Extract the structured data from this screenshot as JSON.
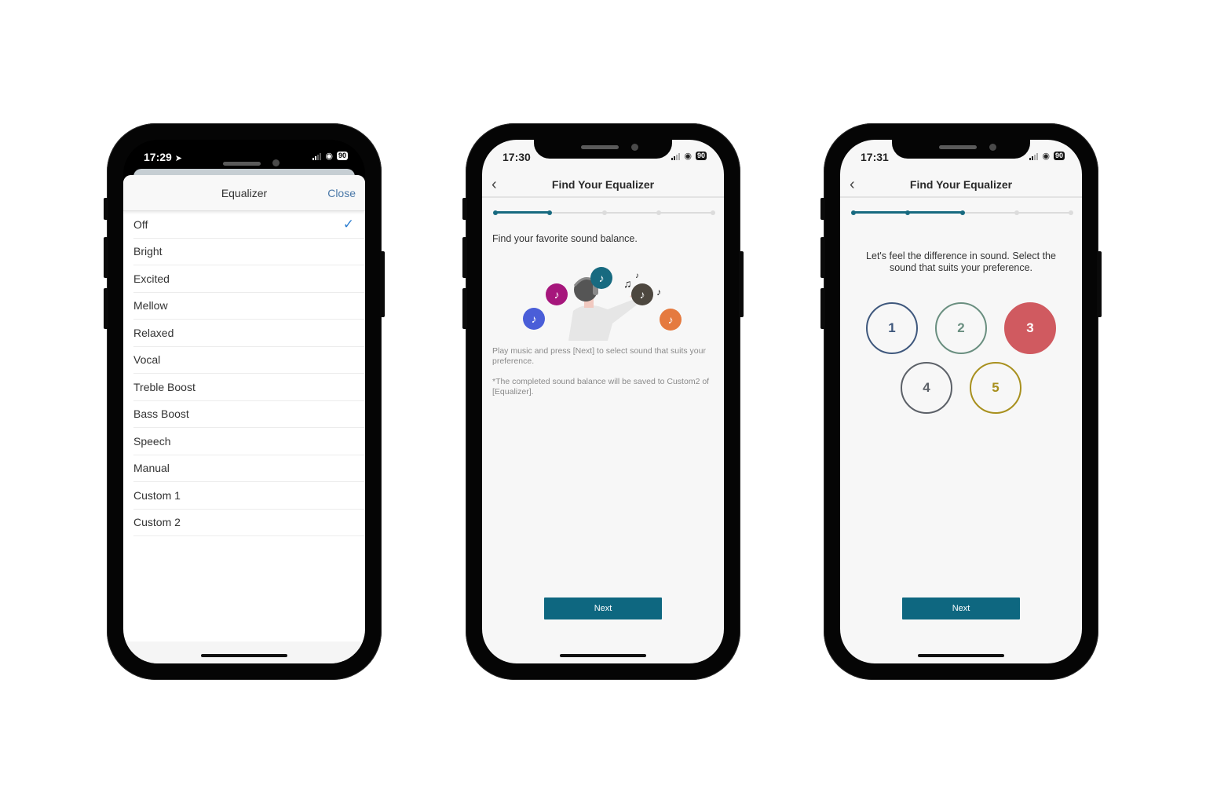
{
  "status_bar": {
    "battery": "90",
    "wifi_icon": "wifi-icon",
    "signal_icon": "cellular-signal-icon"
  },
  "screen1": {
    "time": "17:29",
    "location_icon": "location-arrow-icon",
    "title": "Equalizer",
    "close_label": "Close",
    "selected": "Off",
    "check_icon": "checkmark-icon",
    "items": [
      {
        "label": "Off"
      },
      {
        "label": "Bright"
      },
      {
        "label": "Excited"
      },
      {
        "label": "Mellow"
      },
      {
        "label": "Relaxed"
      },
      {
        "label": "Vocal"
      },
      {
        "label": "Treble Boost"
      },
      {
        "label": "Bass Boost"
      },
      {
        "label": "Speech"
      },
      {
        "label": "Manual"
      },
      {
        "label": "Custom 1"
      },
      {
        "label": "Custom 2"
      }
    ]
  },
  "screen2": {
    "time": "17:30",
    "title": "Find Your Equalizer",
    "back_icon": "chevron-left-icon",
    "progress": {
      "step": 2,
      "total_steps": 5
    },
    "lead": "Find your favorite sound balance.",
    "illustration": "person-with-headphones-and-music-notes",
    "note_icons": [
      "music-note-icon"
    ],
    "bubble_colors": [
      "#4a5ed8",
      "#a6167c",
      "#176a80",
      "#4d473f",
      "#e57a3f"
    ],
    "instruction": "Play music and press [Next] to select sound that suits your preference.",
    "footnote": "*The completed sound balance will be saved to Custom2 of [Equalizer].",
    "next_label": "Next"
  },
  "screen3": {
    "time": "17:31",
    "title": "Find Your Equalizer",
    "back_icon": "chevron-left-icon",
    "progress": {
      "step": 3,
      "total_steps": 5
    },
    "prompt": "Let's feel the difference in sound. Select the sound that suits your preference.",
    "choices": [
      {
        "label": "1",
        "color": "#3f587d",
        "selected": false
      },
      {
        "label": "2",
        "color": "#6a8f80",
        "selected": false
      },
      {
        "label": "3",
        "color": "#d05a60",
        "selected": true
      },
      {
        "label": "4",
        "color": "#5c6168",
        "selected": false
      },
      {
        "label": "5",
        "color": "#a8901e",
        "selected": false
      }
    ],
    "next_label": "Next"
  },
  "colors": {
    "accent": "#0e6780",
    "link": "#4a78a8",
    "check": "#2f7fd0"
  }
}
